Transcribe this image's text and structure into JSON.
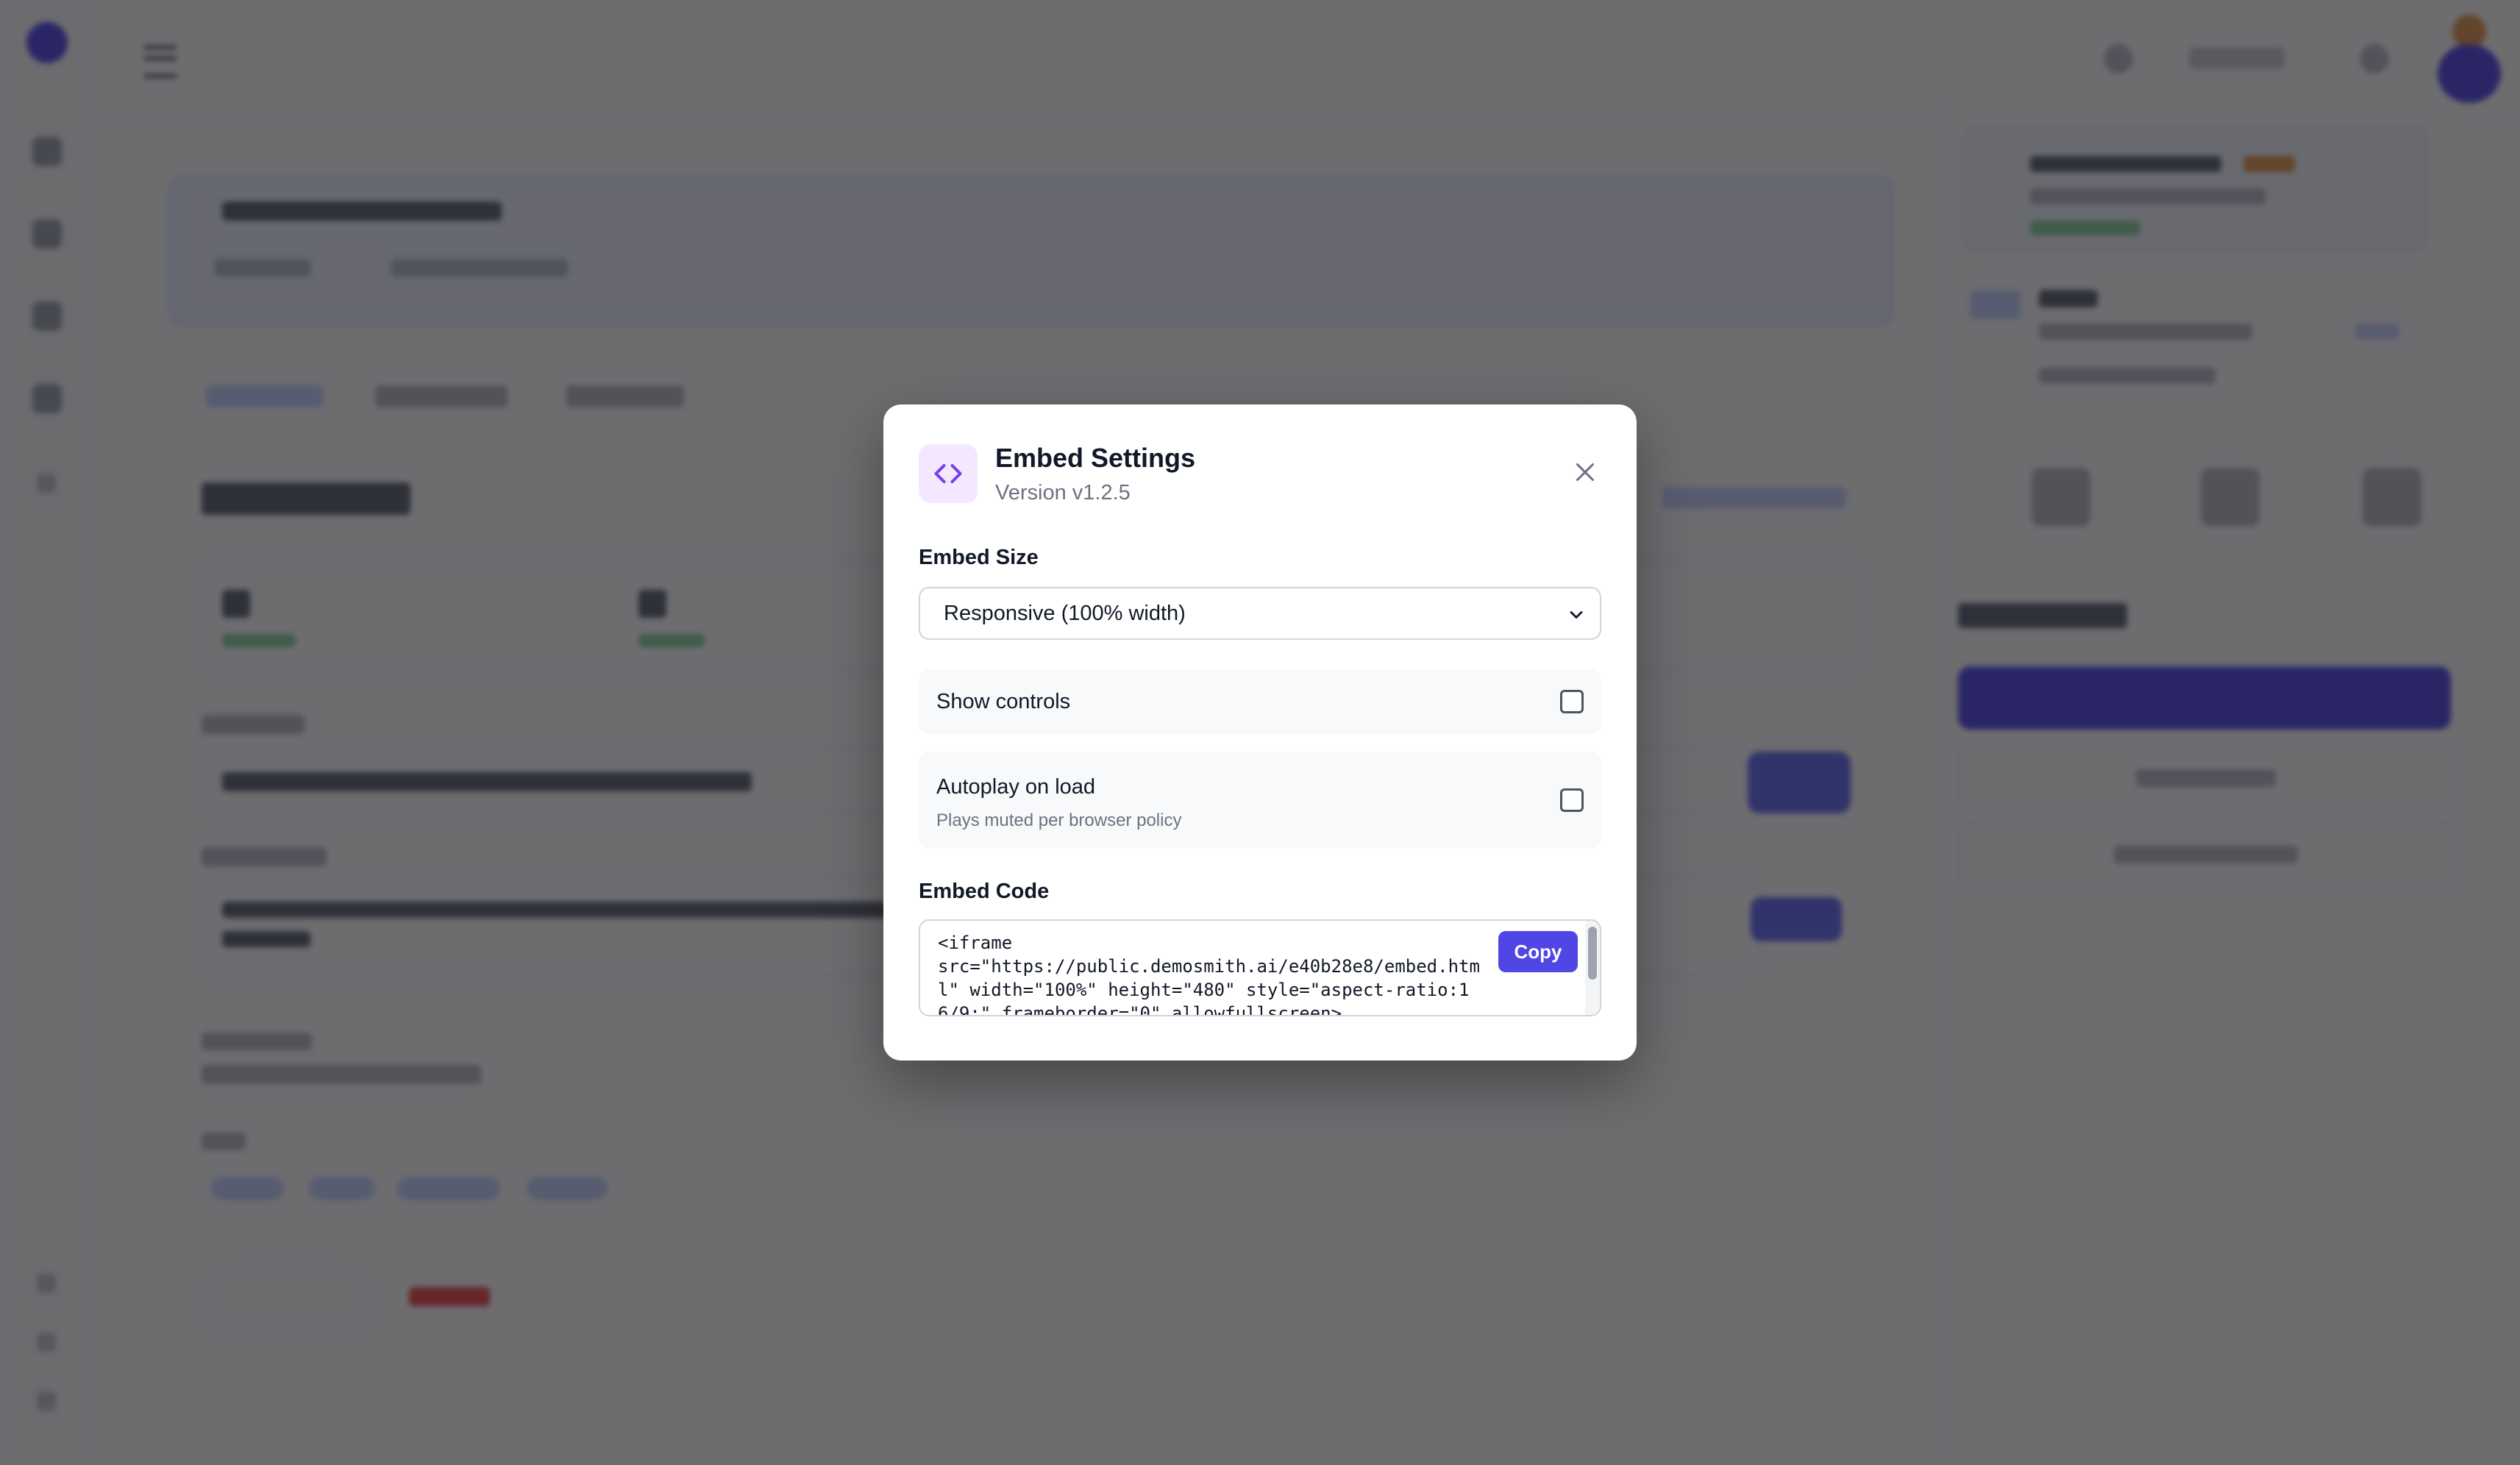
{
  "modal": {
    "title": "Embed Settings",
    "version": "Version v1.2.5",
    "icon": "code-icon",
    "embed_size": {
      "label": "Embed Size",
      "selected": "Responsive (100% width)"
    },
    "options": [
      {
        "label": "Show controls",
        "help": "",
        "checked": false
      },
      {
        "label": "Autoplay on load",
        "help": "Plays muted per browser policy",
        "checked": false
      }
    ],
    "embed_code": {
      "label": "Embed Code",
      "code": "<iframe\nsrc=\"https://public.demosmith.ai/e40b28e8/embed.html\" width=\"100%\" height=\"480\" style=\"aspect-ratio:16/9;\" frameborder=\"0\" allowfullscreen>",
      "copy_label": "Copy"
    }
  },
  "colors": {
    "accent": "#4f46e5",
    "icon_bg": "#f3e8ff",
    "icon_stroke": "#7c3aed",
    "overlay": "rgba(20,20,24,0.62)"
  }
}
